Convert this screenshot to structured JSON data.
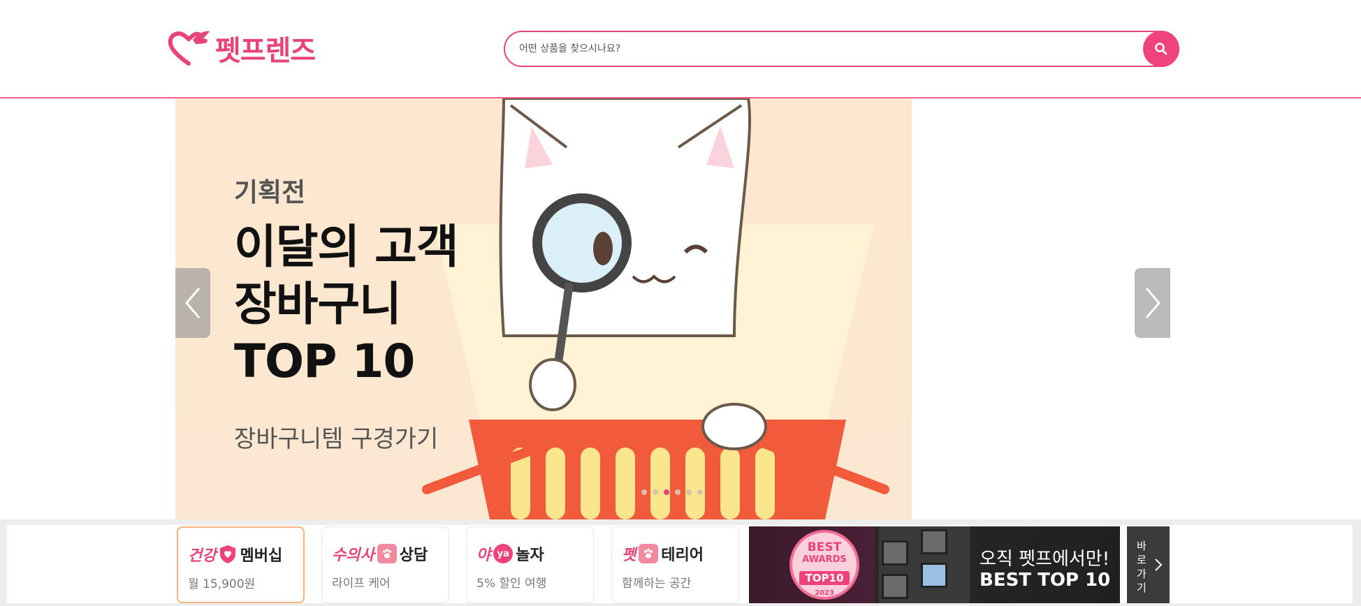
{
  "header": {
    "logo_text": "펫프렌즈",
    "search_placeholder": "어떤 상품을 찾으시나요?"
  },
  "banner": {
    "tag": "기획전",
    "headline_line1": "이달의 고객",
    "headline_line2": "장바구니",
    "headline_line3": "TOP 10",
    "link_text": "장바구니템 구경가기",
    "dots_total": 6,
    "active_dot": 3
  },
  "shortcuts": [
    {
      "title_accent": "건강",
      "title_rest": "멤버십",
      "subtitle": "월 15,900원",
      "icon": "heart-shield-icon",
      "active": true
    },
    {
      "title_accent": "수의사",
      "title_rest": "상담",
      "subtitle": "라이프 케어",
      "icon": "paw-icon",
      "active": false
    },
    {
      "title_accent": "야",
      "title_rest": "놀자",
      "subtitle": "5% 할인 여행",
      "icon": "ya-icon",
      "badge_text": "ya",
      "active": false
    },
    {
      "title_accent": "펫",
      "title_rest": "테리어",
      "subtitle": "함께하는 공간",
      "icon": "paw-icon",
      "active": false
    }
  ],
  "promo": {
    "award_line1": "BEST",
    "award_line2": "AWARDS",
    "award_line3": "TOP10",
    "award_year": "2023",
    "line1": "오직 펫프에서만!",
    "line2": "BEST TOP 10",
    "goto_label": "바로가기"
  },
  "colors": {
    "brand_pink": "#e8437a",
    "banner_bg": "#fde7cf",
    "promo_bg": "#222222"
  }
}
